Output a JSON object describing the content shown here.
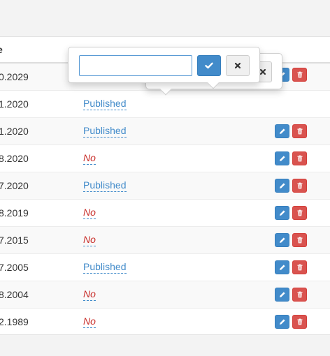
{
  "table": {
    "date_header": "e",
    "rows": [
      {
        "date": "0.2029",
        "status": ""
      },
      {
        "date": "1.2020",
        "status": "Published"
      },
      {
        "date": "1.2020",
        "status": "Published"
      },
      {
        "date": "8.2020",
        "status": "No"
      },
      {
        "date": "7.2020",
        "status": "Published"
      },
      {
        "date": "8.2019",
        "status": "No"
      },
      {
        "date": "7.2015",
        "status": "No"
      },
      {
        "date": "7.2005",
        "status": "Published"
      },
      {
        "date": "8.2004",
        "status": "No"
      },
      {
        "date": "2.1989",
        "status": "No"
      }
    ]
  },
  "popover": {
    "input_value": "",
    "input_placeholder": ""
  },
  "icons": {
    "confirm": "check-icon",
    "cancel": "times-icon",
    "edit": "pencil-icon",
    "delete": "trash-icon"
  },
  "colors": {
    "primary": "#428bca",
    "danger": "#d9534f",
    "no_text": "#c9302c"
  }
}
